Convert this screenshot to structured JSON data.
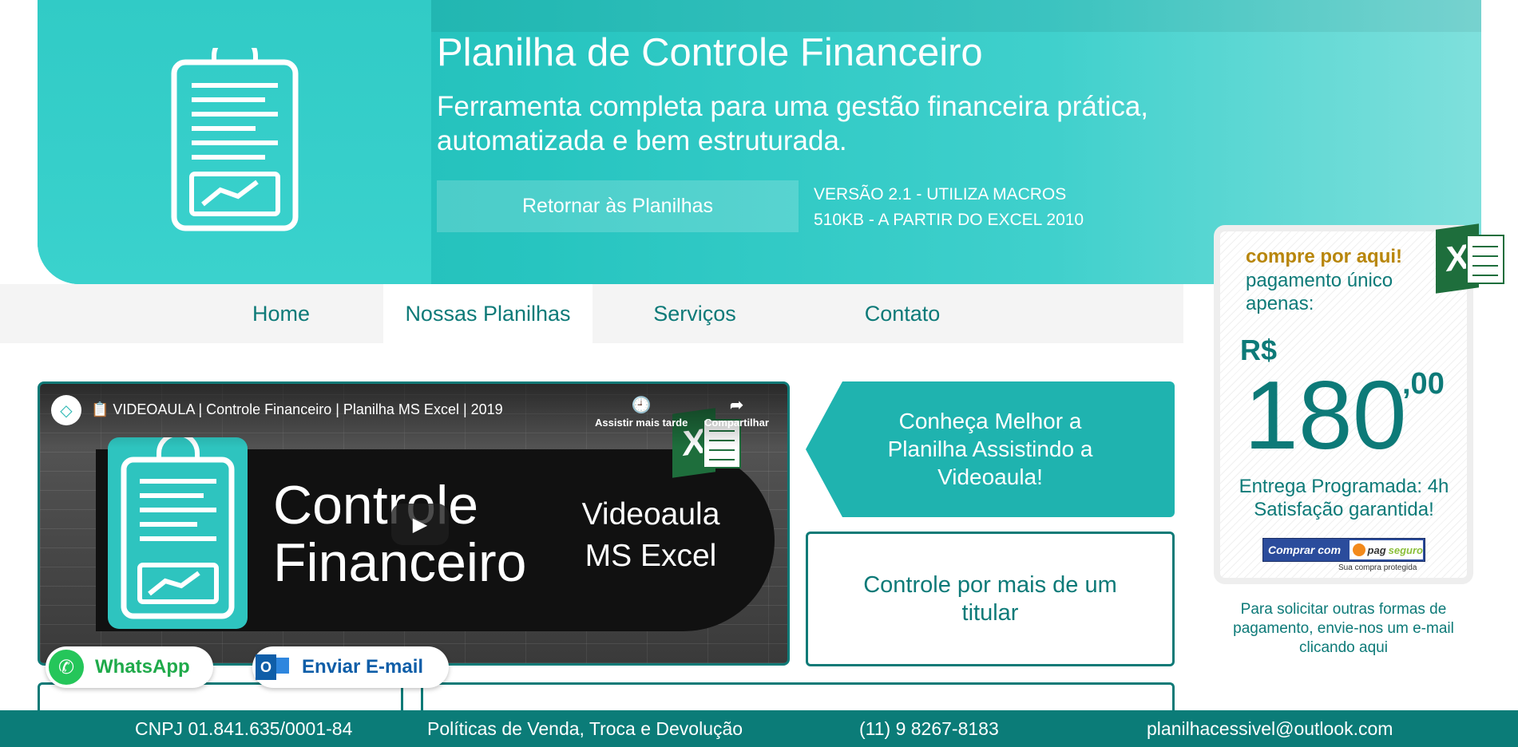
{
  "hero": {
    "title": "Planilha de Controle Financeiro",
    "subtitle": "Ferramenta completa para uma gestão financeira prática, automatizada e bem estruturada.",
    "return_label": "Retornar às Planilhas",
    "version_line1": "VERSÃO 2.1 - UTILIZA MACROS",
    "version_line2": "510KB - A PARTIR DO EXCEL 2010"
  },
  "nav": {
    "items": [
      {
        "label": "Home"
      },
      {
        "label": "Nossas Planilhas",
        "active": true
      },
      {
        "label": "Serviços"
      },
      {
        "label": "Contato"
      }
    ]
  },
  "video": {
    "title": "📋 VIDEOAULA | Controle Financeiro | Planilha MS Excel | 2019",
    "watch_later": "Assistir mais tarde",
    "share": "Compartilhar",
    "thumb_title_line1": "Controle",
    "thumb_title_line2": "Financeiro",
    "thumb_sub_line1": "Videoaula",
    "thumb_sub_line2": "MS Excel"
  },
  "cta": {
    "video_text": "Conheça Melhor a Planilha Assistindo a Videoaula!",
    "feature_text": "Controle por mais de um titular"
  },
  "price": {
    "compre": "compre por aqui!",
    "pagamento": "pagamento único apenas:",
    "currency": "R$",
    "amount": "180",
    "cents": ",00",
    "delivery_line1": "Entrega Programada: 4h",
    "delivery_line2": "Satisfação garantida!",
    "pag_button_left": "Comprar com",
    "pag_button_brand_a": "pag",
    "pag_button_brand_b": "seguro",
    "protegida": "Sua compra protegida",
    "solicitar": "Para solicitar outras formas de pagamento, envie-nos um e-mail clicando aqui"
  },
  "floating": {
    "whatsapp": "WhatsApp",
    "email": "Enviar E-mail"
  },
  "footer": {
    "cnpj": "CNPJ 01.841.635/0001-84",
    "politicas": "Políticas de Venda, Troca e Devolução",
    "phone": "(11) 9 8267-8183",
    "email": "planilhacessivel@outlook.com"
  },
  "colors": {
    "teal_dark": "#0b7c78",
    "teal": "#1fb3af",
    "gold": "#b8860b",
    "excel_green": "#1e6e3c"
  }
}
